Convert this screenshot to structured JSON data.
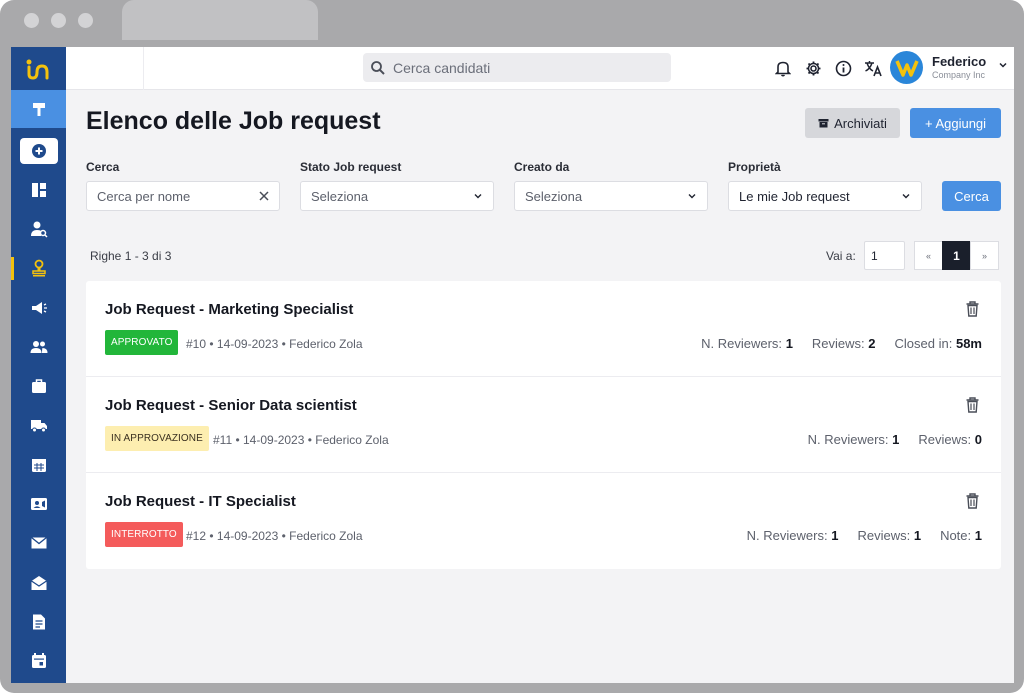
{
  "search": {
    "placeholder": "Cerca candidati"
  },
  "user": {
    "name": "Federico",
    "company": "Company Inc"
  },
  "page": {
    "title": "Elenco delle Job request",
    "archive_label": "Archiviati",
    "add_label": "+ Aggiungi"
  },
  "filters": {
    "cerca_label": "Cerca",
    "cerca_placeholder": "Cerca per nome",
    "stato_label": "Stato Job request",
    "stato_value": "Seleziona",
    "creato_label": "Creato da",
    "creato_value": "Seleziona",
    "proprieta_label": "Proprietà",
    "proprieta_value": "Le mie Job request",
    "search_button": "Cerca"
  },
  "pagination": {
    "rows_info": "Righe 1 - 3 di 3",
    "goto_label": "Vai a:",
    "goto_value": "1",
    "prev": "«",
    "current": "1",
    "next": "»"
  },
  "jobs": [
    {
      "title": "Job Request - Marketing Specialist",
      "status": "APPROVATO",
      "meta": "#10 • 14-09-2023 • Federico Zola",
      "stats": [
        {
          "label": "N. Reviewers:",
          "value": "1"
        },
        {
          "label": "Reviews:",
          "value": "2"
        },
        {
          "label": "Closed in:",
          "value": "58m"
        }
      ]
    },
    {
      "title": "Job Request - Senior Data scientist",
      "status": "IN APPROVAZIONE",
      "meta": "#11 • 14-09-2023 • Federico Zola",
      "stats": [
        {
          "label": "N. Reviewers:",
          "value": "1"
        },
        {
          "label": "Reviews:",
          "value": "0"
        }
      ]
    },
    {
      "title": "Job Request - IT Specialist",
      "status": "INTERROTTO",
      "meta": "#12 • 14-09-2023 • Federico Zola",
      "stats": [
        {
          "label": "N. Reviewers:",
          "value": "1"
        },
        {
          "label": "Reviews:",
          "value": "1"
        },
        {
          "label": "Note:",
          "value": "1"
        }
      ]
    }
  ],
  "colors": {
    "primary": "#4a90e2",
    "sidebar": "#1f4a8c",
    "approved": "#22b63a",
    "pending": "#fdeeb0",
    "stopped": "#f45b5b"
  }
}
